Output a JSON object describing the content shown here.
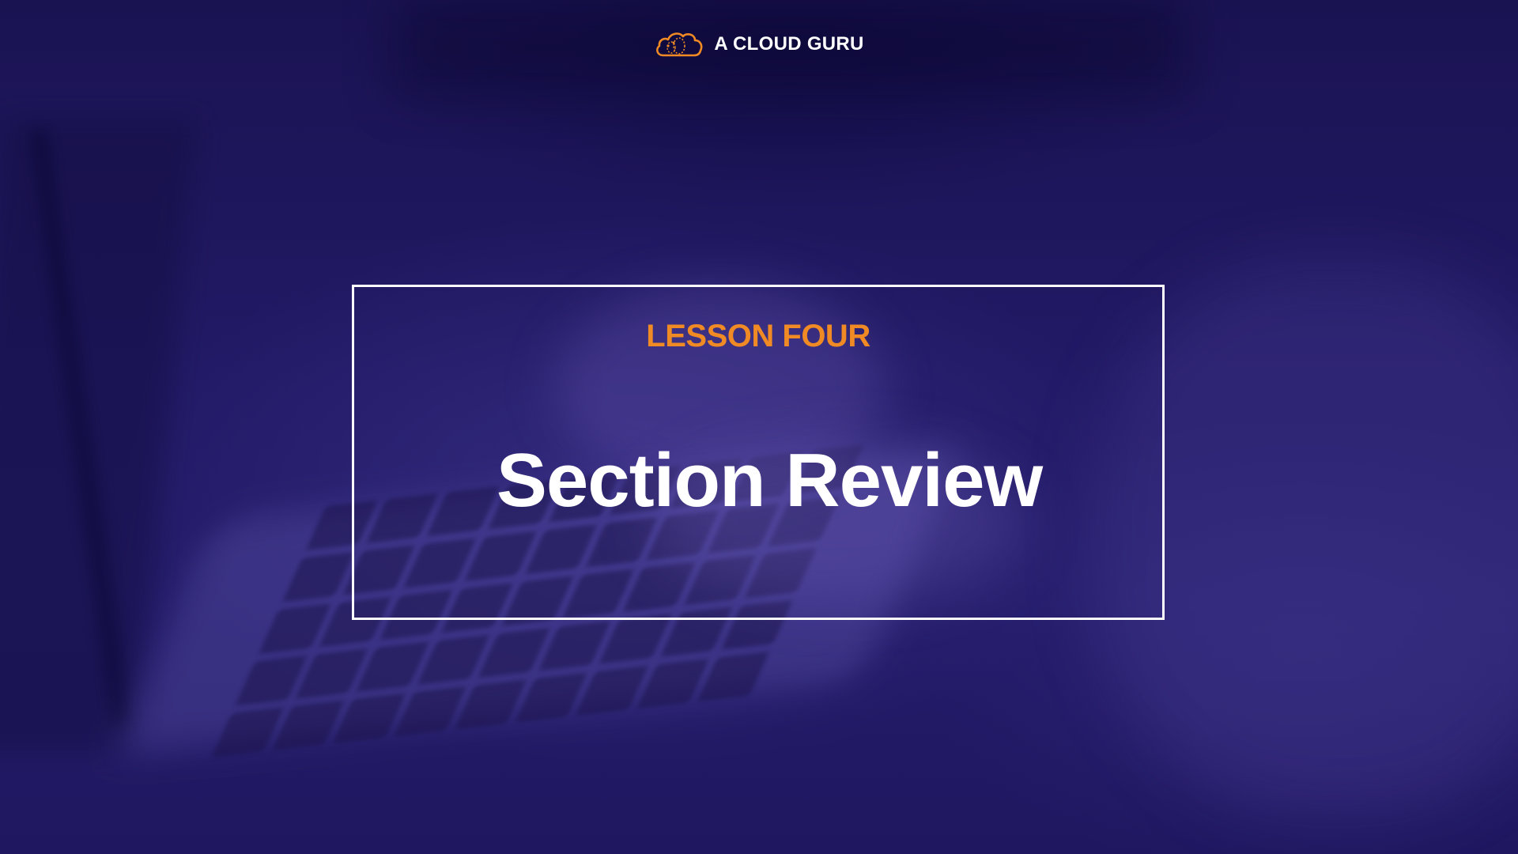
{
  "brand": {
    "name": "A CLOUD GURU",
    "logo_icon": "cloud-logo-icon",
    "logo_color": "#f08a24"
  },
  "slide": {
    "lesson_label": "LESSON FOUR",
    "title": "Section Review"
  },
  "colors": {
    "background": "#221a66",
    "accent": "#f08a24",
    "frame": "#ffffff",
    "text": "#ffffff"
  }
}
